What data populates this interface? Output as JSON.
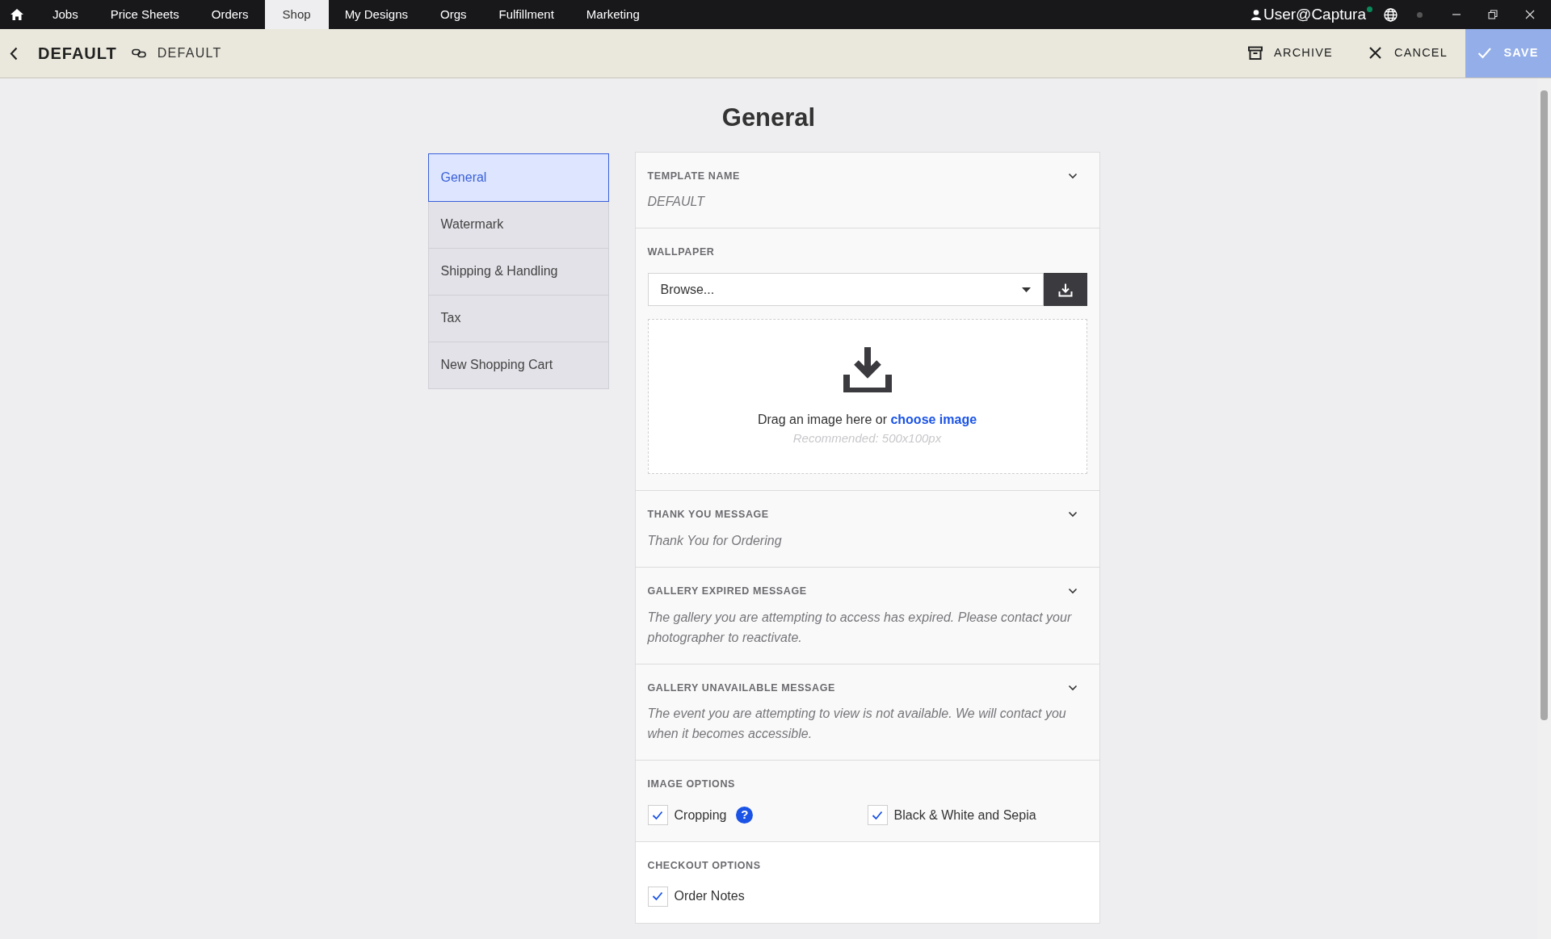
{
  "top_nav": {
    "items": [
      {
        "label": "Jobs",
        "selected": false
      },
      {
        "label": "Price Sheets",
        "selected": false
      },
      {
        "label": "Orders",
        "selected": false
      },
      {
        "label": "Shop",
        "selected": true
      },
      {
        "label": "My Designs",
        "selected": false
      },
      {
        "label": "Orgs",
        "selected": false
      },
      {
        "label": "Fulfillment",
        "selected": false
      },
      {
        "label": "Marketing",
        "selected": false
      }
    ],
    "user": "User@Captura"
  },
  "header": {
    "title": "DEFAULT",
    "link_label": "DEFAULT",
    "actions": [
      {
        "kind": "archive",
        "label": "ARCHIVE"
      },
      {
        "kind": "cancel",
        "label": "CANCEL"
      },
      {
        "kind": "save",
        "label": "SAVE"
      }
    ]
  },
  "page_title": "General",
  "sidebar": {
    "items": [
      {
        "label": "General",
        "selected": true
      },
      {
        "label": "Watermark",
        "selected": false
      },
      {
        "label": "Shipping & Handling",
        "selected": false
      },
      {
        "label": "Tax",
        "selected": false
      },
      {
        "label": "New Shopping Cart",
        "selected": false
      }
    ]
  },
  "sections": [
    {
      "kind": "text",
      "label": "TEMPLATE NAME",
      "value": "DEFAULT"
    },
    {
      "kind": "upload",
      "label": "WALLPAPER",
      "select_value": "Browse...",
      "drop_text": "Drag an image here or",
      "drop_link": "choose image",
      "hint": "Recommended: 500x100px"
    },
    {
      "kind": "text",
      "label": "THANK YOU MESSAGE",
      "value": "Thank You for Ordering"
    },
    {
      "kind": "text",
      "label": "GALLERY EXPIRED MESSAGE",
      "value": "The gallery you are attempting to access has expired. Please contact your photographer to reactivate."
    },
    {
      "kind": "text",
      "label": "GALLERY UNAVAILABLE MESSAGE",
      "value": "The event you are attempting to view is not available. We will contact you when it becomes accessible."
    },
    {
      "kind": "options",
      "label": "IMAGE OPTIONS",
      "options": [
        {
          "label": "Cropping",
          "checked": true,
          "help": "?"
        },
        {
          "label": "Black & White and Sepia",
          "checked": true
        }
      ]
    },
    {
      "kind": "options",
      "label": "CHECKOUT OPTIONS",
      "options": [
        {
          "label": "Order Notes",
          "checked": true
        }
      ]
    }
  ]
}
